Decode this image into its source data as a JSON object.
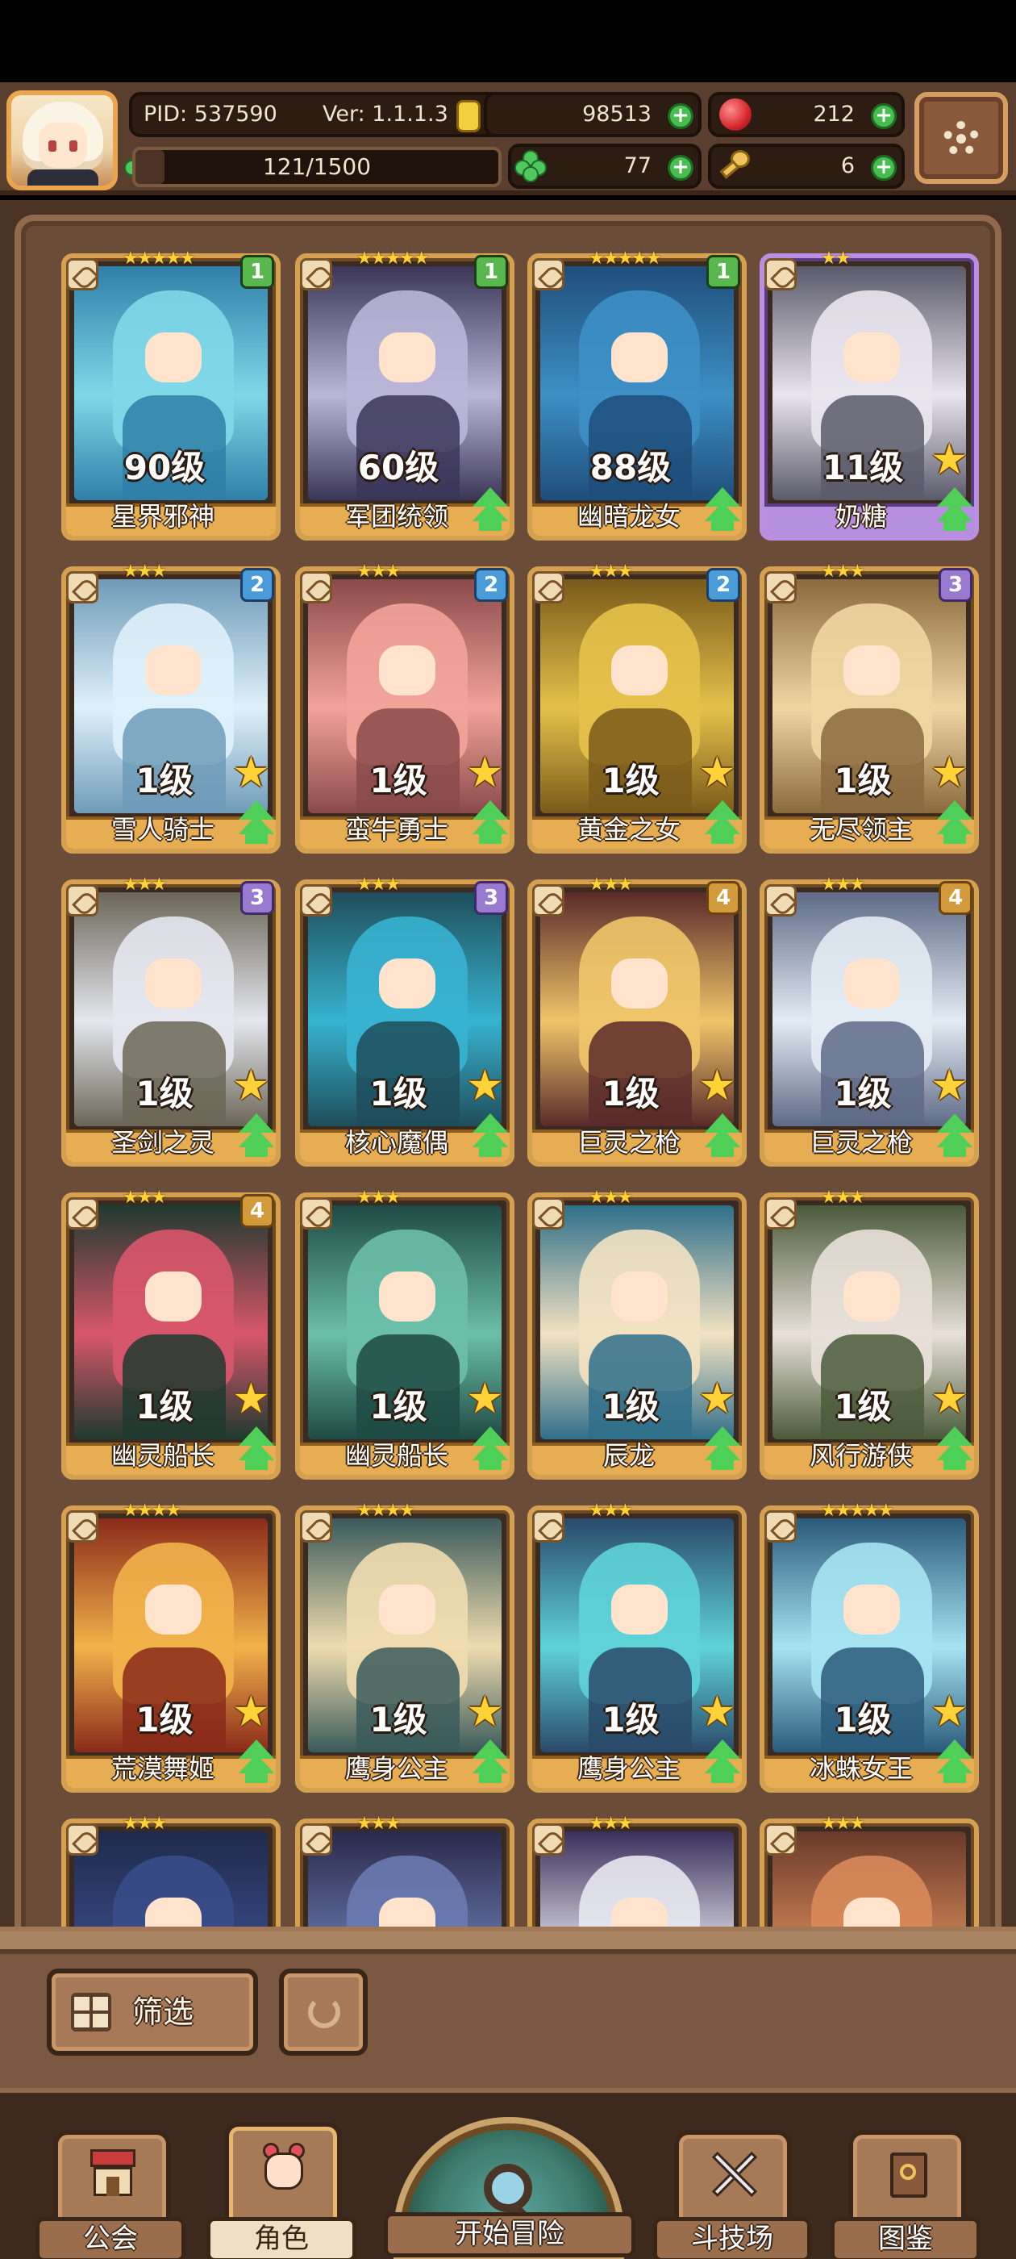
{
  "header": {
    "pid_label": "PID: 537590",
    "version_label": "Ver: 1.1.1.3",
    "gold": "98513",
    "gems": "212",
    "exp_progress": "121/1500",
    "exp_fraction": 0.081,
    "clover": "77",
    "keys": "6",
    "avatar_icon": "hero-portrait-icon",
    "settings_icon": "gear-icon"
  },
  "heroes": [
    {
      "name": "星界邪神",
      "level": "90级",
      "stars": "★★★★★",
      "rank": "1",
      "frame": "gold",
      "palette": [
        "#2f7fa8",
        "#7fd8e8"
      ]
    },
    {
      "name": "军团统领",
      "level": "60级",
      "stars": "★★★★★",
      "rank": "1",
      "frame": "gold",
      "palette": [
        "#3b3658",
        "#b9b6d8"
      ]
    },
    {
      "name": "幽暗龙女",
      "level": "88级",
      "stars": "★★★★★",
      "rank": "1",
      "frame": "gold",
      "palette": [
        "#1f4e7a",
        "#3d8fc4"
      ]
    },
    {
      "name": "奶糖",
      "level": "11级",
      "stars": "★★",
      "rank": "",
      "frame": "purple",
      "palette": [
        "#5b5a6a",
        "#e9e5ef"
      ]
    },
    {
      "name": "雪人骑士",
      "level": "1级",
      "stars": "★★★",
      "rank": "2",
      "frame": "gold",
      "palette": [
        "#6f9bb8",
        "#dff1fa"
      ]
    },
    {
      "name": "蛮牛勇士",
      "level": "1级",
      "stars": "★★★",
      "rank": "2",
      "frame": "gold",
      "palette": [
        "#8a4a4a",
        "#f2a39a"
      ]
    },
    {
      "name": "黄金之女",
      "level": "1级",
      "stars": "★★★",
      "rank": "2",
      "frame": "gold",
      "palette": [
        "#7a5a1a",
        "#e5c14a"
      ]
    },
    {
      "name": "无尽领主",
      "level": "1级",
      "stars": "★★★",
      "rank": "3",
      "frame": "gold",
      "palette": [
        "#8a6a3e",
        "#f0d7a2"
      ]
    },
    {
      "name": "圣剑之灵",
      "level": "1级",
      "stars": "★★★",
      "rank": "3",
      "frame": "gold",
      "palette": [
        "#6b6657",
        "#e5e7ef"
      ]
    },
    {
      "name": "核心魔偶",
      "level": "1级",
      "stars": "★★★",
      "rank": "3",
      "frame": "gold",
      "palette": [
        "#1f4e5a",
        "#37b3d0"
      ]
    },
    {
      "name": "巨灵之枪",
      "level": "1级",
      "stars": "★★★",
      "rank": "4",
      "frame": "gold",
      "palette": [
        "#5a2a2a",
        "#f0c56a"
      ]
    },
    {
      "name": "巨灵之枪",
      "level": "1级",
      "stars": "★★★",
      "rank": "4",
      "frame": "gold",
      "palette": [
        "#5e6a86",
        "#e3ecf4"
      ]
    },
    {
      "name": "幽灵船长",
      "level": "1级",
      "stars": "★★★",
      "rank": "4",
      "frame": "gold",
      "palette": [
        "#1f3a2f",
        "#d8576a"
      ]
    },
    {
      "name": "幽灵船长",
      "level": "1级",
      "stars": "★★★",
      "rank": "",
      "frame": "gold",
      "palette": [
        "#1f4a44",
        "#6bbfa8"
      ]
    },
    {
      "name": "辰龙",
      "level": "1级",
      "stars": "★★★",
      "rank": "",
      "frame": "gold",
      "palette": [
        "#2f6f8a",
        "#f2e2c2"
      ]
    },
    {
      "name": "风行游侠",
      "level": "1级",
      "stars": "★★★",
      "rank": "",
      "frame": "gold",
      "palette": [
        "#4a5a3a",
        "#e8e0d8"
      ]
    },
    {
      "name": "荒漠舞姬",
      "level": "1级",
      "stars": "★★★★",
      "rank": "",
      "frame": "gold",
      "palette": [
        "#8a2a1a",
        "#f2b24a"
      ]
    },
    {
      "name": "鹰身公主",
      "level": "1级",
      "stars": "★★★★",
      "rank": "",
      "frame": "gold",
      "palette": [
        "#3a5a5a",
        "#f0dcb0"
      ]
    },
    {
      "name": "鹰身公主",
      "level": "1级",
      "stars": "★★★",
      "rank": "",
      "frame": "gold",
      "palette": [
        "#2a4a6a",
        "#5fd3d8"
      ]
    },
    {
      "name": "冰蛛女王",
      "level": "1级",
      "stars": "★★★★★",
      "rank": "",
      "frame": "gold",
      "palette": [
        "#2a5a7a",
        "#a6e4f2"
      ]
    },
    {
      "name": "",
      "level": "",
      "stars": "★★★",
      "rank": "",
      "frame": "gold",
      "palette": [
        "#1f2a4a",
        "#3a4c8a"
      ]
    },
    {
      "name": "",
      "level": "",
      "stars": "★★★",
      "rank": "",
      "frame": "gold",
      "palette": [
        "#2a2a4a",
        "#6a7ab0"
      ]
    },
    {
      "name": "",
      "level": "",
      "stars": "★★★",
      "rank": "",
      "frame": "gold",
      "palette": [
        "#3a2f5a",
        "#e8e8f0"
      ]
    },
    {
      "name": "",
      "level": "",
      "stars": "★★★",
      "rank": "",
      "frame": "gold",
      "palette": [
        "#6a3a2a",
        "#d88a5a"
      ]
    }
  ],
  "filter": {
    "label": "筛选",
    "filter_icon": "grid-icon",
    "refresh_icon": "refresh-icon"
  },
  "nav": {
    "guild": "公会",
    "hero": "角色",
    "adventure": "开始冒险",
    "arena": "斗技场",
    "codex": "图鉴"
  },
  "colors": {
    "panel_bg": "#6b4c38",
    "frame_gold": "#d5a04f",
    "frame_purple": "#b98fe0",
    "star": "#ffd338",
    "upgrade_green": "#4fcf57"
  }
}
